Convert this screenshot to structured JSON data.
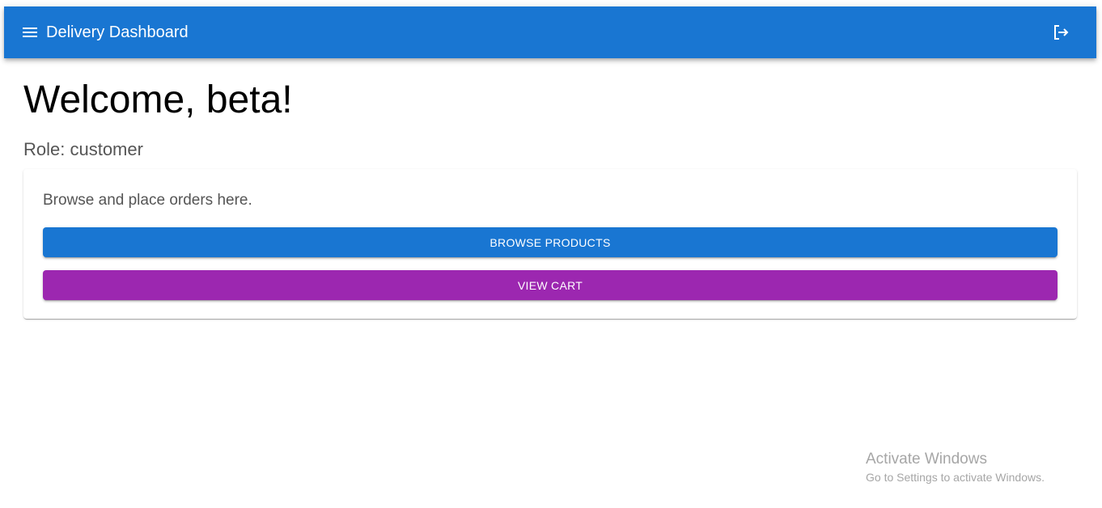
{
  "appbar": {
    "title": "Delivery Dashboard",
    "menu_icon": "menu-icon",
    "logout_icon": "logout-icon",
    "color": "#1976d2"
  },
  "main": {
    "welcome": "Welcome, beta!",
    "role": "Role: customer"
  },
  "card": {
    "text": "Browse and place orders here.",
    "browse_label": "BROWSE PRODUCTS",
    "browse_color": "#1976d2",
    "cart_label": "VIEW CART",
    "cart_color": "#9c27b0"
  },
  "watermark": {
    "title": "Activate Windows",
    "subtitle": "Go to Settings to activate Windows."
  }
}
